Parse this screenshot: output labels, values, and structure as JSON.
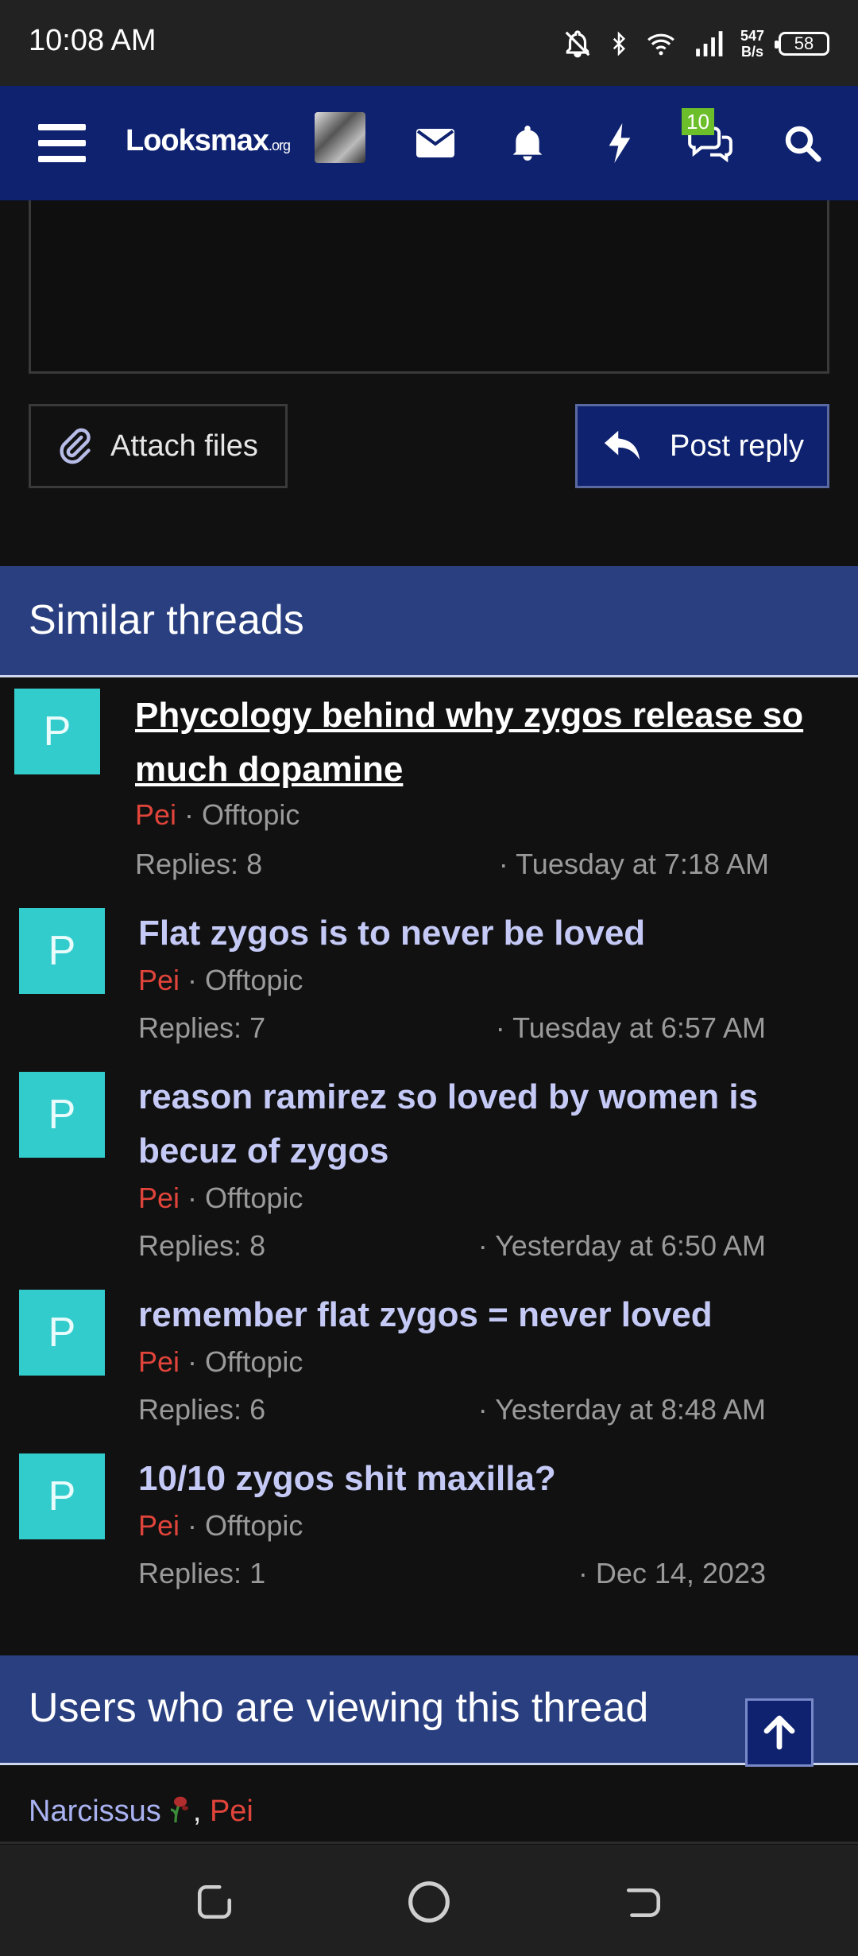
{
  "status_bar": {
    "time": "10:08 AM",
    "net_speed_value": "547",
    "net_speed_unit": "B/s",
    "battery": "58",
    "icons": [
      "do-not-disturb-icon",
      "bluetooth-icon",
      "wifi-icon",
      "signal-icon"
    ]
  },
  "navbar": {
    "logo_main": "Looksmax",
    "logo_suffix": ".org",
    "chat_badge": "10",
    "icons": [
      "menu-icon",
      "avatar",
      "mail-icon",
      "bell-icon",
      "bolt-icon",
      "chat-icon",
      "search-icon"
    ]
  },
  "composer": {
    "attach_label": "Attach files",
    "post_label": "Post reply"
  },
  "similar_threads": {
    "title": "Similar threads",
    "items": [
      {
        "avatar_letter": "P",
        "title": "Phycology behind why zygos release so much dopamine",
        "author": "Pei",
        "forum": "Offtopic",
        "replies": "Replies: 8",
        "date": "Tuesday at 7:18 AM"
      },
      {
        "avatar_letter": "P",
        "title": "Flat zygos is to never be loved",
        "author": "Pei",
        "forum": "Offtopic",
        "replies": "Replies: 7",
        "date": "Tuesday at 6:57 AM"
      },
      {
        "avatar_letter": "P",
        "title": "reason ramirez so loved by women is becuz of zygos",
        "author": "Pei",
        "forum": "Offtopic",
        "replies": "Replies: 8",
        "date": "Yesterday at 6:50 AM"
      },
      {
        "avatar_letter": "P",
        "title": "remember flat zygos = never loved",
        "author": "Pei",
        "forum": "Offtopic",
        "replies": "Replies: 6",
        "date": "Yesterday at 8:48 AM"
      },
      {
        "avatar_letter": "P",
        "title": "10/10 zygos shit maxilla?",
        "author": "Pei",
        "forum": "Offtopic",
        "replies": "Replies: 1",
        "date": "Dec 14, 2023"
      }
    ]
  },
  "viewing": {
    "title": "Users who are viewing this thread",
    "users": [
      "Narcissus",
      "Pei"
    ],
    "separator": ", "
  },
  "colors": {
    "nav_bg": "#0e2270",
    "section_bg": "#2a3f80",
    "avatar_bg": "#33cccc",
    "author_red": "#e0443a",
    "link": "#c4c9f5"
  }
}
